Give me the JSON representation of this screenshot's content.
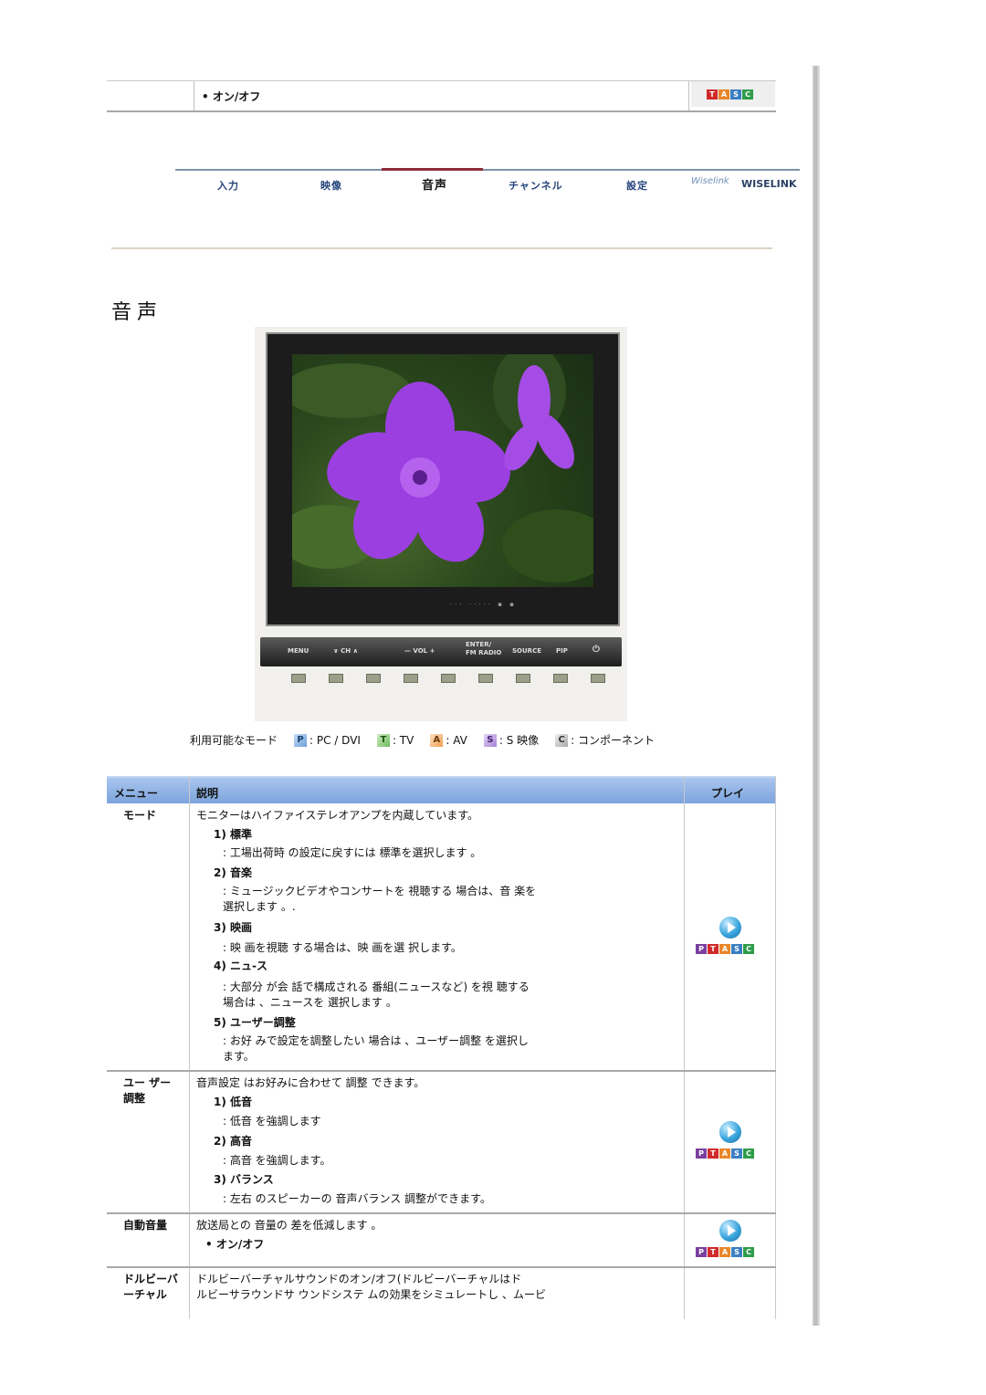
{
  "top_strip": {
    "label": "• オン/オフ"
  },
  "tasc_letters": [
    "T",
    "A",
    "S",
    "C"
  ],
  "ptasc_letters": [
    "P",
    "T",
    "A",
    "S",
    "C"
  ],
  "nav": {
    "items": [
      "入力",
      "映像",
      "音声",
      "チャンネル",
      "設定"
    ],
    "active": "音声",
    "logo_mark": "Wiselink",
    "logo_text": "WISELINK"
  },
  "page_title": "音声",
  "monitor": {
    "bezel_text": "MENU ∨ CH ∧ — VOL + ENTER/ FM RADIO SOURCE PIP",
    "buttons": [
      "MENU",
      "∨ CH ∧",
      "— VOL +",
      "ENTER/ FM RADIO",
      "SOURCE",
      "PIP",
      "⏻"
    ]
  },
  "modes": {
    "label": "利用可能なモード",
    "items": [
      {
        "icon": "P",
        "text": ": PC / DVI",
        "icon_class": "icon-pc"
      },
      {
        "icon": "T",
        "text": ": TV",
        "icon_class": "icon-tv"
      },
      {
        "icon": "A",
        "text": ": AV",
        "icon_class": "icon-av"
      },
      {
        "icon": "S",
        "text": ": S 映像",
        "icon_class": "icon-s"
      },
      {
        "icon": "C",
        "text": ": コンポーネント",
        "icon_class": "icon-comp"
      }
    ]
  },
  "table": {
    "headers": {
      "menu": "メニュー",
      "desc": "説明",
      "play": "プレイ"
    },
    "rows": {
      "mode": {
        "label": "モード",
        "intro": "モニターはハイファイステレオアンプを内蔵しています。",
        "s1_title": "1) 標準",
        "s1_text": ": 工場出荷時 の設定に戻すには 標準を選択します 。",
        "s2_title": "2) 音楽",
        "s2_text_1": ": ミュージックビデオやコンサートを 視聴する 場合は、音 楽を",
        "s2_text_2": "選択します 。.",
        "s3_title": "3) 映画",
        "s3_text": ": 映 画を視聴 する場合は、映 画を選 択します。",
        "s4_title": "4) ニュ-ス",
        "s4_text_1": ": 大部分 が会 話で構成される 番組(ニュースなど) を視 聴する",
        "s4_text_2": "場合は 、ニュースを 選択します 。",
        "s5_title": "5) ユーザー調整",
        "s5_text_1": ": お好 みで設定を調整したい 場合は 、ユーザー調整 を選択し",
        "s5_text_2": "ます。"
      },
      "user": {
        "label_1": "ユー ザー",
        "label_2": "調整",
        "intro": "音声設定 はお好みに合わせて 調整 できます。",
        "s1_title": "1) 低音",
        "s1_text": ": 低音 を強調します",
        "s2_title": "2) 高音",
        "s2_text": ": 高音 を強調します。",
        "s3_title": "3) バランス",
        "s3_text": ": 左右 のスピーカーの 音声バランス 調整ができます。"
      },
      "auto": {
        "label": "自動音量",
        "intro": "放送局との 音量の 差を低減します 。",
        "sub": "• オン/オフ"
      },
      "dolby": {
        "label_1": "ドルビーバ",
        "label_2": "ーチャル",
        "text_1": "ドルビーバーチャルサウンドのオン/オフ(ドルビーバーチャルはド",
        "text_2": "ルビーサラウンドサ ウンドシステ ムの効果をシミュレートし 、ムービ"
      }
    }
  },
  "colors": {
    "tasc": [
      "#d02a2a",
      "#e8872a",
      "#3b7fc2",
      "#2f9c4a"
    ],
    "ptasc": [
      "#7a3fa0",
      "#d02a2a",
      "#e8872a",
      "#3b7fc2",
      "#2f9c4a"
    ]
  }
}
